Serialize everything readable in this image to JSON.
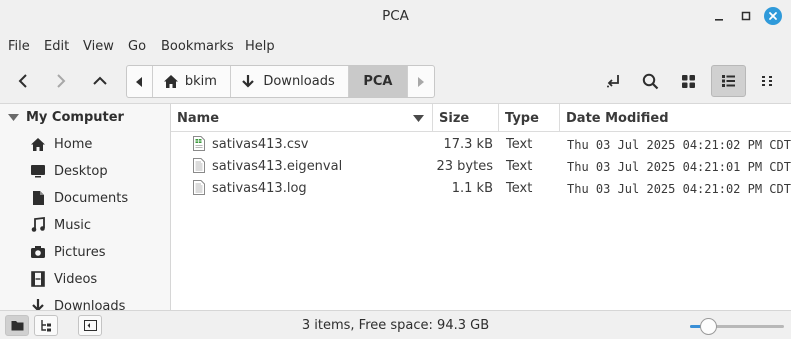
{
  "window": {
    "title": "PCA"
  },
  "menubar": [
    "File",
    "Edit",
    "View",
    "Go",
    "Bookmarks",
    "Help"
  ],
  "pathbar": {
    "crumbs": [
      "bkim",
      "Downloads",
      "PCA"
    ]
  },
  "sidebar": {
    "header": "My Computer",
    "items": [
      {
        "label": "Home",
        "icon": "home-icon"
      },
      {
        "label": "Desktop",
        "icon": "desktop-icon"
      },
      {
        "label": "Documents",
        "icon": "documents-icon"
      },
      {
        "label": "Music",
        "icon": "music-icon"
      },
      {
        "label": "Pictures",
        "icon": "pictures-icon"
      },
      {
        "label": "Videos",
        "icon": "videos-icon"
      },
      {
        "label": "Downloads",
        "icon": "downloads-icon"
      }
    ]
  },
  "list": {
    "columns": [
      "Name",
      "Size",
      "Type",
      "Date Modified"
    ],
    "rows": [
      {
        "name": "sativas413.csv",
        "size": "17.3 kB",
        "type": "Text",
        "modified": "Thu 03 Jul 2025 04:21:02 PM CDT",
        "icon": "spreadsheet-file-icon"
      },
      {
        "name": "sativas413.eigenval",
        "size": "23 bytes",
        "type": "Text",
        "modified": "Thu 03 Jul 2025 04:21:01 PM CDT",
        "icon": "text-file-icon"
      },
      {
        "name": "sativas413.log",
        "size": "1.1 kB",
        "type": "Text",
        "modified": "Thu 03 Jul 2025 04:21:02 PM CDT",
        "icon": "text-file-icon"
      }
    ]
  },
  "statusbar": {
    "text": "3 items, Free space: 94.3 GB",
    "zoom_level": 0.2
  },
  "colors": {
    "accent": "#3a8fd6",
    "close_button": "#2f9ada"
  }
}
